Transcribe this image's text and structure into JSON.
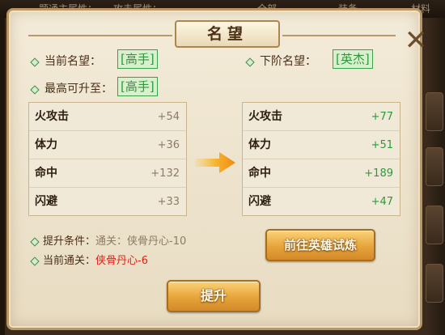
{
  "background": {
    "tabs_text": [
      "题通主属性：",
      "攻击属性：",
      "全部",
      "装备",
      "材料"
    ]
  },
  "dialog": {
    "title": "名望",
    "current_label": "当前名望：",
    "current_value": "[高手]",
    "next_label": "下阶名望：",
    "next_value": "[英杰]",
    "max_label": "最高可升至：",
    "max_value": "[高手]"
  },
  "current_stats": [
    {
      "name": "火攻击",
      "value": "+54"
    },
    {
      "name": "体力",
      "value": "+36"
    },
    {
      "name": "命中",
      "value": "+132"
    },
    {
      "name": "闪避",
      "value": "+33"
    }
  ],
  "next_stats": [
    {
      "name": "火攻击",
      "value": "+77"
    },
    {
      "name": "体力",
      "value": "+51"
    },
    {
      "name": "命中",
      "value": "+189"
    },
    {
      "name": "闪避",
      "value": "+47"
    }
  ],
  "conditions": {
    "requirement_label": "提升条件：",
    "requirement_value": "通关：侠骨丹心-10",
    "current_label": "当前通关：",
    "current_value": "侠骨丹心-6"
  },
  "buttons": {
    "trial": "前往英雄试炼",
    "upgrade": "提升"
  },
  "icons": {
    "close": "close-icon",
    "bullet": "diamond-bullet-icon",
    "arrow": "arrow-right-icon"
  },
  "colors": {
    "green": "#2a9a3a",
    "red": "#e0201a",
    "button": "#e6a43a"
  }
}
